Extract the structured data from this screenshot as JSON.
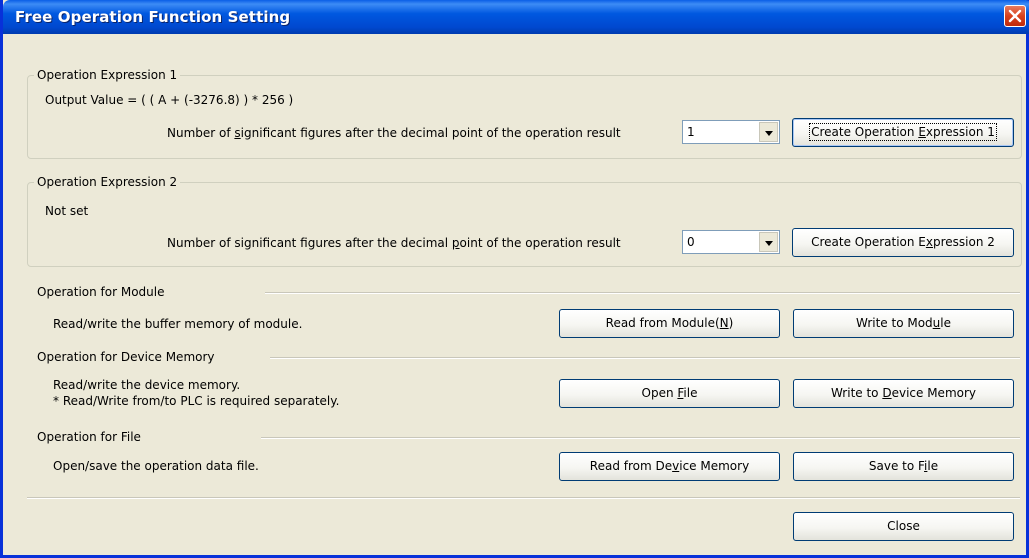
{
  "window": {
    "title": "Free Operation Function Setting"
  },
  "expr1": {
    "legend": "Operation Expression 1",
    "formula": "Output Value = ( ( A + (-3276.8) ) * 256 )",
    "sig_label_before": "Number of ",
    "sig_label_mnemonic": "s",
    "sig_label_after": "ignificant figures after the decimal point of the operation result",
    "sig_value": "1",
    "create_before": "Create Operation ",
    "create_mnemonic": "E",
    "create_after": "xpression 1"
  },
  "expr2": {
    "legend": "Operation Expression 2",
    "status": "Not set",
    "sig_label_before": "Number of significant figures after the decimal ",
    "sig_label_mnemonic": "p",
    "sig_label_after": "oint of the operation result",
    "sig_value": "0",
    "create_before": "Create Operation E",
    "create_mnemonic": "x",
    "create_after": "pression 2"
  },
  "module": {
    "header": "Operation for Module",
    "desc": "Read/write the buffer memory of module.",
    "read_before": "Read from Module(",
    "read_mnemonic": "N",
    "read_after": ")",
    "write_before": "Write to Mod",
    "write_mnemonic": "u",
    "write_after": "le"
  },
  "device": {
    "header": "Operation for Device Memory",
    "desc_line1": "Read/write the device memory.",
    "desc_line2": "* Read/Write from/to PLC is required separately.",
    "open_before": "Open ",
    "open_mnemonic": "F",
    "open_after": "ile",
    "write_before": "Write to ",
    "write_mnemonic": "D",
    "write_after": "evice Memory"
  },
  "file": {
    "header": "Operation for File",
    "desc": "Open/save the operation data file.",
    "read_before": "Read from De",
    "read_mnemonic": "v",
    "read_after": "ice Memory",
    "save_before": "Save to F",
    "save_mnemonic": "i",
    "save_after": "le"
  },
  "footer": {
    "close_label": "Close"
  }
}
